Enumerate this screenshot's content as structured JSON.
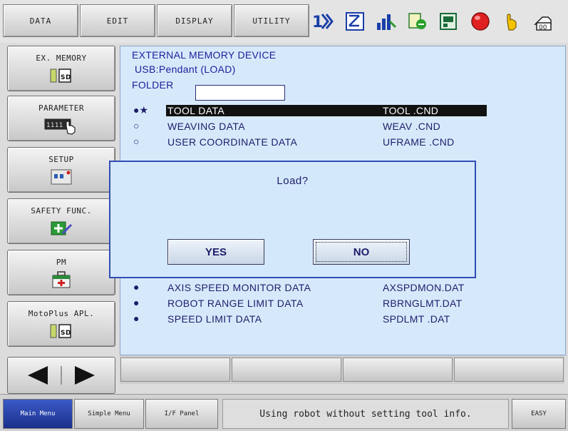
{
  "top_menu": {
    "data": "DATA",
    "edit": "EDIT",
    "display": "DISPLAY",
    "utility": "UTILITY"
  },
  "status_icons": [
    "cycle-icon",
    "edit-icon",
    "chart-icon",
    "job-icon",
    "panel-icon",
    "alarm-icon",
    "hand-icon",
    "key-icon"
  ],
  "sidebar": {
    "items": [
      {
        "label": "EX. MEMORY",
        "icon": "sd-card-icon"
      },
      {
        "label": "PARAMETER",
        "icon": "parameter-hand-icon"
      },
      {
        "label": "SETUP",
        "icon": "setup-icon"
      },
      {
        "label": "SAFETY FUNC.",
        "icon": "safety-icon"
      },
      {
        "label": "PM",
        "icon": "first-aid-icon"
      },
      {
        "label": "MotoPlus APL.",
        "icon": "sd-card-icon"
      }
    ]
  },
  "main": {
    "title": "EXTERNAL MEMORY DEVICE",
    "device": "USB:Pendant (LOAD)",
    "folder_label": "FOLDER",
    "folder_value": "",
    "rows": [
      {
        "mark": "●★",
        "name": "TOOL DATA",
        "file": "TOOL     .CND",
        "selected": true
      },
      {
        "mark": "○",
        "name": "WEAVING DATA",
        "file": "WEAV     .CND"
      },
      {
        "mark": "○",
        "name": "USER COORDINATE DATA",
        "file": "UFRAME   .CND"
      },
      {
        "mark": "●",
        "name": "AXIS SPEED MONITOR DATA",
        "file": "AXSPDMON.DAT"
      },
      {
        "mark": "●",
        "name": "ROBOT RANGE LIMIT DATA",
        "file": "RBRNGLMT.DAT"
      },
      {
        "mark": "●",
        "name": "SPEED LIMIT DATA",
        "file": "SPDLMT   .DAT"
      }
    ]
  },
  "dialog": {
    "title": "Load?",
    "yes": "YES",
    "no": "NO"
  },
  "bottom": {
    "main_menu": "Main Menu",
    "simple_menu": "Simple Menu",
    "if_panel": "I/F Panel",
    "message": "Using robot without setting tool info.",
    "easy": "EASY"
  },
  "colors": {
    "main_bg": "#d6e9fb",
    "text_blue": "#1d1d6a",
    "dialog_border": "#2f4db5",
    "active_button": "#2a44a8"
  }
}
